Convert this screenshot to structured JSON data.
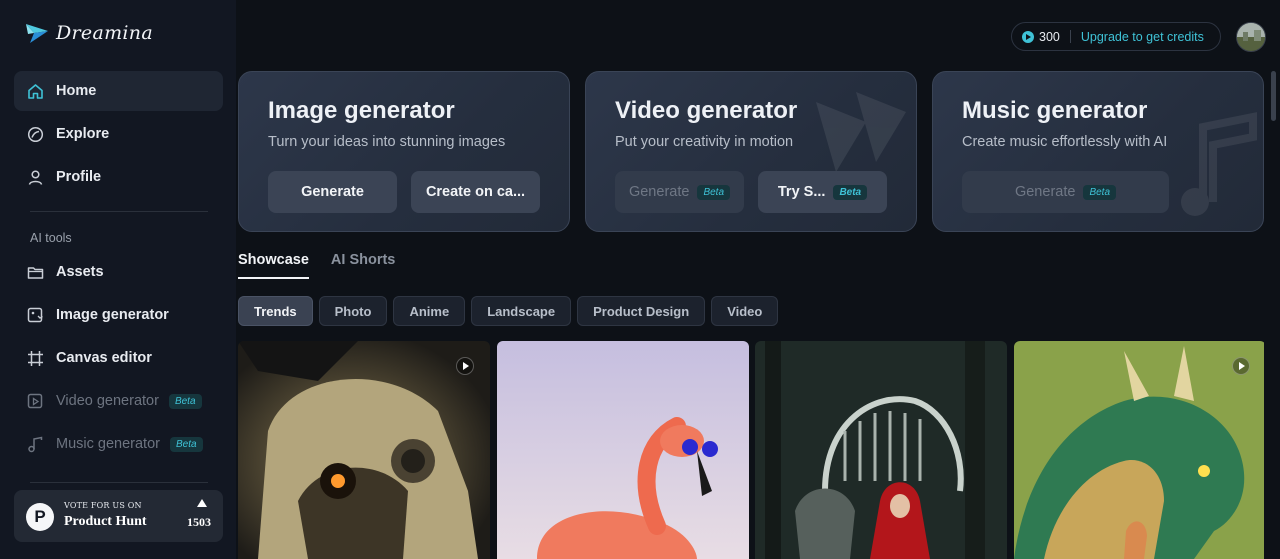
{
  "app": {
    "brand": "Dreamina"
  },
  "sidebar": {
    "nav": [
      {
        "label": "Home",
        "icon": "home-icon",
        "active": true
      },
      {
        "label": "Explore",
        "icon": "explore-icon"
      },
      {
        "label": "Profile",
        "icon": "profile-icon"
      }
    ],
    "section_label": "AI tools",
    "tools": [
      {
        "label": "Assets",
        "icon": "folder-icon"
      },
      {
        "label": "Image generator",
        "icon": "image-generator-icon"
      },
      {
        "label": "Canvas editor",
        "icon": "canvas-icon"
      },
      {
        "label": "Video generator",
        "icon": "video-icon",
        "badge": "Beta",
        "disabled": true
      },
      {
        "label": "Music generator",
        "icon": "music-icon",
        "badge": "Beta",
        "disabled": true
      }
    ],
    "product_hunt": {
      "small": "VOTE FOR US ON",
      "name": "Product Hunt",
      "count": "1503",
      "logo_letter": "P"
    }
  },
  "header": {
    "credits": "300",
    "upgrade_link": "Upgrade to get credits"
  },
  "generators": [
    {
      "title": "Image generator",
      "subtitle": "Turn your ideas into stunning images",
      "btn1": "Generate",
      "btn2": "Create on ca..."
    },
    {
      "title": "Video generator",
      "subtitle": "Put your creativity in motion",
      "btn1": "Generate",
      "btn1_badge": "Beta",
      "btn2": "Try S...",
      "btn2_badge": "Beta"
    },
    {
      "title": "Music generator",
      "subtitle": "Create music effortlessly with AI",
      "btn1": "Generate",
      "btn1_badge": "Beta"
    }
  ],
  "tabs": [
    "Showcase",
    "AI Shorts"
  ],
  "chips": [
    "Trends",
    "Photo",
    "Anime",
    "Landscape",
    "Product Design",
    "Video"
  ],
  "colors": {
    "accent": "#3fc2d6",
    "bg": "#0d1117",
    "sidebar": "#121722"
  }
}
